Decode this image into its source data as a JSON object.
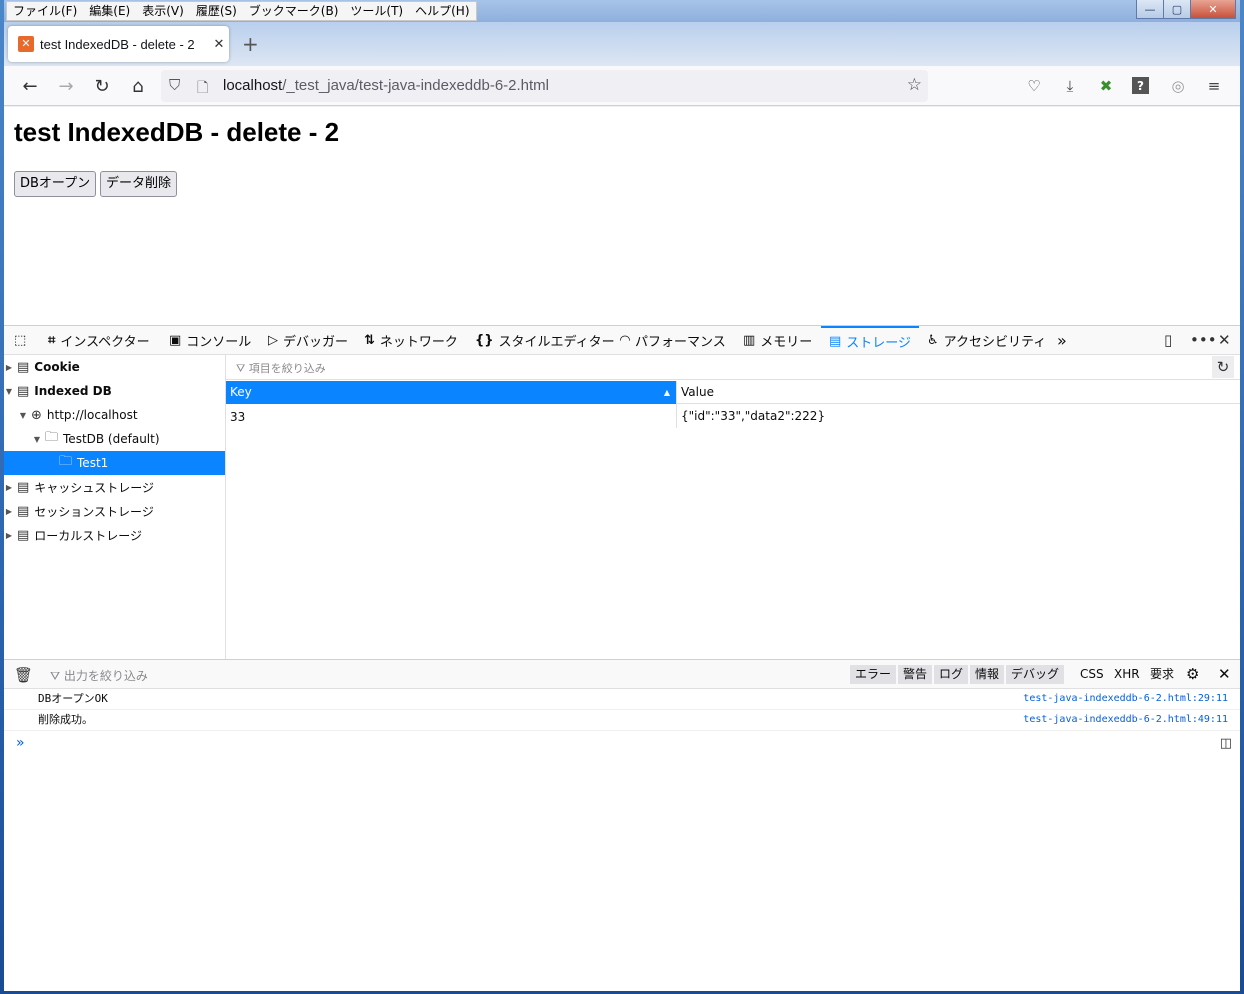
{
  "menubar": [
    "ファイル(F)",
    "編集(E)",
    "表示(V)",
    "履歴(S)",
    "ブックマーク(B)",
    "ツール(T)",
    "ヘルプ(H)"
  ],
  "window_buttons": {
    "minimize": "—",
    "maximize": "▢",
    "close": "✕"
  },
  "tab": {
    "title": "test IndexedDB - delete - 2",
    "close": "✕",
    "new_tab": "+"
  },
  "nav": {
    "back": "←",
    "forward": "→",
    "reload": "↻",
    "home": "⌂",
    "url_host": "localhost",
    "url_path": "/_test_java/test-java-indexeddb-6-2.html"
  },
  "page": {
    "heading": "test IndexedDB - delete - 2",
    "buttons": [
      "DBオープン",
      "データ削除"
    ]
  },
  "devtools": {
    "tabs": [
      {
        "icon": "inspector-icon",
        "label": "インスペクター"
      },
      {
        "icon": "console-icon",
        "label": "コンソール"
      },
      {
        "icon": "debugger-icon",
        "label": "デバッガー"
      },
      {
        "icon": "network-icon",
        "label": "ネットワーク"
      },
      {
        "icon": "style-editor-icon",
        "label": "スタイルエディター"
      },
      {
        "icon": "performance-icon",
        "label": "パフォーマンス"
      },
      {
        "icon": "memory-icon",
        "label": "メモリー"
      },
      {
        "icon": "storage-icon",
        "label": "ストレージ"
      },
      {
        "icon": "accessibility-icon",
        "label": "アクセシビリティ"
      }
    ],
    "active_tab": "ストレージ",
    "sidebar": {
      "cookie": "Cookie",
      "indexed_db": "Indexed DB",
      "origin": "http://localhost",
      "database": "TestDB (default)",
      "store": "Test1",
      "cache": "キャッシュストレージ",
      "session": "セッションストレージ",
      "local": "ローカルストレージ"
    },
    "filter_placeholder": "項目を絞り込み",
    "table": {
      "columns": [
        "Key",
        "Value"
      ],
      "rows": [
        {
          "key": "33",
          "value": "{\"id\":\"33\",\"data2\":222}"
        }
      ]
    }
  },
  "console": {
    "filter_placeholder": "出力を絞り込み",
    "levels": [
      "エラー",
      "警告",
      "ログ",
      "情報",
      "デバッグ"
    ],
    "extra_filters": [
      "CSS",
      "XHR",
      "要求"
    ],
    "messages": [
      {
        "text": "DBオープンOK",
        "source": "test-java-indexeddb-6-2.html:29:11"
      },
      {
        "text": "削除成功。",
        "source": "test-java-indexeddb-6-2.html:49:11"
      }
    ],
    "prompt": "»"
  },
  "colors": {
    "accent": "#0a84ff",
    "link": "#0060df"
  }
}
